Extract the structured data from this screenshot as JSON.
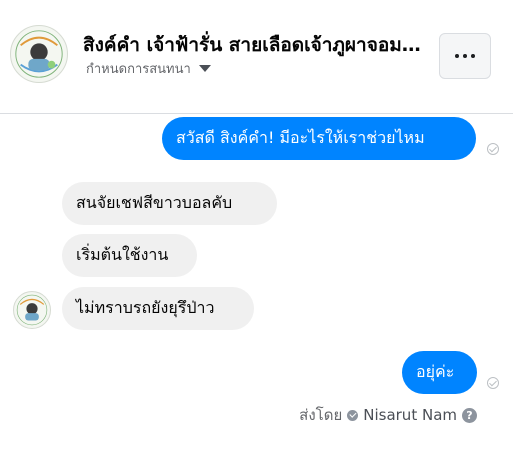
{
  "header": {
    "title": "สิงค์คำ เจ้าฟ้ารั่น สายเลือดเจ้าภูผาจอมหลวง",
    "subtitle": "กำหนดการสนทนา"
  },
  "messages": [
    {
      "direction": "outgoing",
      "text": "สวัสดี สิงค์คำ! มีอะไรให้เราช่วยไหม"
    },
    {
      "direction": "incoming",
      "text": "สนจัยเชฟสีขาวบอลคับ"
    },
    {
      "direction": "incoming",
      "text": "เริ่มต้นใช้งาน"
    },
    {
      "direction": "incoming",
      "text": "ไม่ทราบรถยังยุรึป่าว"
    },
    {
      "direction": "outgoing",
      "text": "อยุ่ค่ะ"
    }
  ],
  "footer": {
    "sent_by_label": "ส่งโดย",
    "sender_name": "Nisarut Nam",
    "help_glyph": "?"
  },
  "icons": {
    "more": "more-horizontal-icon",
    "caret": "caret-down-icon",
    "read": "read-check-icon"
  },
  "colors": {
    "outgoing_bubble": "#0084ff",
    "incoming_bubble": "#f0f0f0"
  }
}
